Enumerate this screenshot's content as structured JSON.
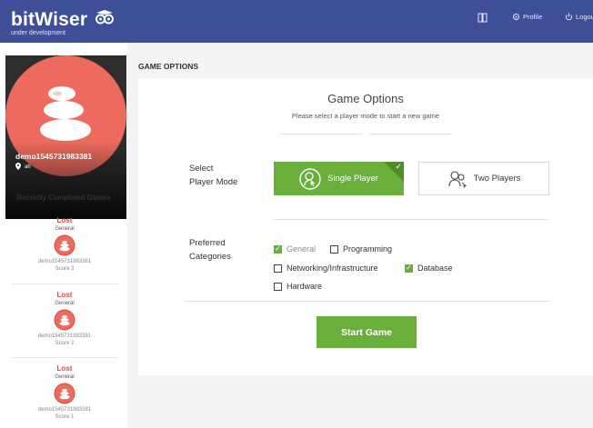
{
  "header": {
    "brand": "bitWiser",
    "tagline": "under development",
    "nav": {
      "profile_label": "Profile",
      "logout_label": "Logou"
    },
    "bg_color": "#3e4f98"
  },
  "sidebar": {
    "profile": {
      "username": "demo1545731983381",
      "location": "ah"
    },
    "recent_title": "Recently Completed Games",
    "games": [
      {
        "result": "Lost",
        "category": "General",
        "user": "demo1545731983381",
        "score": "Score 3"
      },
      {
        "result": "Lost",
        "category": "General",
        "user": "demo1545731983381",
        "score": "Score 2"
      },
      {
        "result": "Lost",
        "category": "General",
        "user": "demo1545731983381",
        "score": "Score 1"
      }
    ]
  },
  "main": {
    "section_title": "GAME OPTIONS",
    "panel": {
      "title": "Game Options",
      "subtitle": "Please select a player mode to start a new game",
      "player_mode": {
        "label_line1": "Select",
        "label_line2": "Player Mode",
        "options": [
          {
            "label": "Single Player",
            "selected": true
          },
          {
            "label": "Two Players",
            "selected": false
          }
        ]
      },
      "categories": {
        "label_line1": "Preferred",
        "label_line2": "Categories",
        "options": [
          {
            "label": "General",
            "checked": true,
            "disabled": true
          },
          {
            "label": "Programming",
            "checked": false
          },
          {
            "label": "Networking/Infrastructure",
            "checked": false
          },
          {
            "label": "Database",
            "checked": true
          },
          {
            "label": "Hardware",
            "checked": false
          }
        ]
      },
      "start_label": "Start Game"
    }
  },
  "colors": {
    "accent_green": "#6aae3c",
    "lost_red": "#e3483b",
    "avatar_coral": "#ec6a5e"
  }
}
